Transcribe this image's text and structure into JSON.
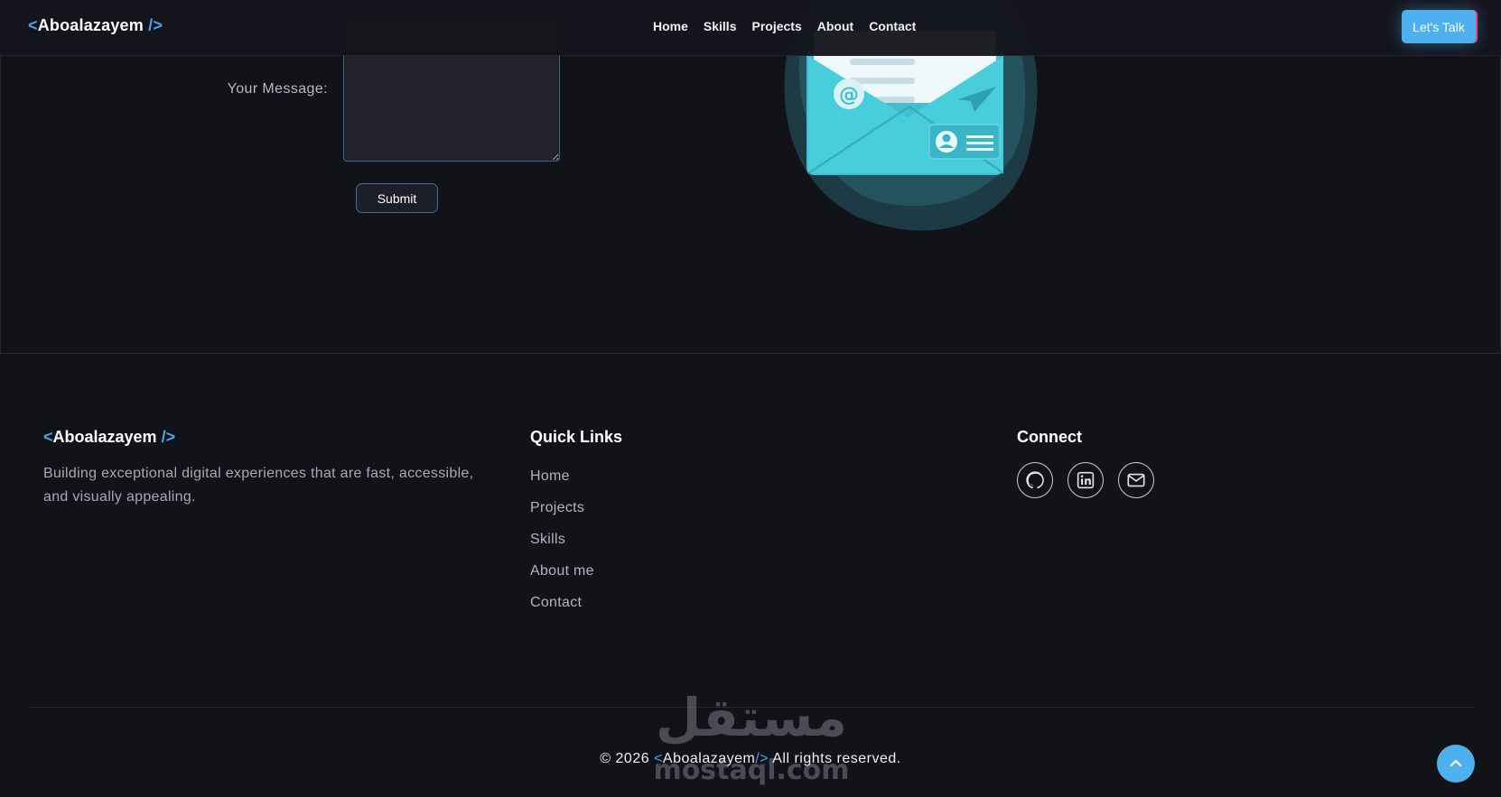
{
  "header": {
    "logo": {
      "open": "<",
      "name": "Aboalazayem",
      "close": " />"
    },
    "nav": [
      "Home",
      "Skills",
      "Projects",
      "About",
      "Contact"
    ],
    "cta": "Let's Talk"
  },
  "contact_form": {
    "message_label": "Your Message:",
    "message_value": "",
    "submit_label": "Submit"
  },
  "footer": {
    "logo": {
      "open": "<",
      "name": "Aboalazayem",
      "close": " />"
    },
    "description": "Building exceptional digital experiences that are fast, accessible, and visually appealing.",
    "quick_links_title": "Quick Links",
    "quick_links": [
      "Home",
      "Projects",
      "Skills",
      "About me",
      "Contact"
    ],
    "connect_title": "Connect",
    "social": [
      {
        "name": "github",
        "icon": "github-icon"
      },
      {
        "name": "linkedin",
        "icon": "linkedin-icon"
      },
      {
        "name": "email",
        "icon": "mail-icon"
      }
    ],
    "copyright": {
      "prefix": "© 2026 ",
      "open": "<",
      "name": "Aboalazayem",
      "close": "/>",
      "suffix": " All rights reserved."
    }
  },
  "watermark": {
    "arabic": "مستقل",
    "latin": "mostaql.com"
  },
  "colors": {
    "background": "#121219",
    "accent": "#4aa3e8",
    "button": "#4eb0ee",
    "envelope": "#4ccbdc"
  }
}
